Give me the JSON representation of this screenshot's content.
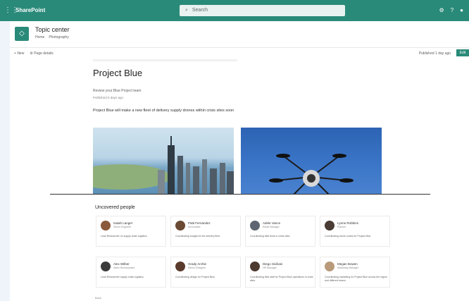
{
  "suitebar": {
    "app_name": "SharePoint",
    "search_placeholder": "Search",
    "waffle_icon": "waffle-icon",
    "icons": [
      "settings-icon",
      "help-icon",
      "avatar-icon"
    ]
  },
  "site": {
    "title": "Topic center",
    "nav": [
      "Home",
      "Photography"
    ]
  },
  "commandbar": {
    "new_label": "New",
    "page_details_label": "Page details",
    "status_label": "Published 1 day ago",
    "publish_label": "Edit"
  },
  "page": {
    "title": "Project Blue",
    "author": "Review your Blue Project team",
    "date": "Published 5 days ago",
    "intro": "Project Blue will make a new fleet of delivery supply drones within crisis sites soon"
  },
  "people_section": {
    "title": "Uncovered people",
    "people": [
      {
        "name": "Isaiah Langer",
        "role": "Senior Engineer",
        "desc": "Lead Researcher on supply chain logistics"
      },
      {
        "name": "Patti Fernandez",
        "role": "Accountant",
        "desc": "Coordinating budget for the delivery fleet"
      },
      {
        "name": "Adele Vance",
        "role": "Retail Manager",
        "desc": "Coordinating field tests in crisis sites"
      },
      {
        "name": "Lynne Robbins",
        "role": "Planner",
        "desc": "Coordinating drone routes for Project Blue"
      },
      {
        "name": "Alex Wilber",
        "role": "Sales Development",
        "desc": "Lead Researcher supply chain logistics"
      },
      {
        "name": "Grady Archie",
        "role": "Senior Designer",
        "desc": "Coordinating design for Project Blue"
      },
      {
        "name": "Diego Siciliani",
        "role": "HR Manager",
        "desc": "Coordinating field staff for Project Blue operations in crisis sites"
      },
      {
        "name": "Megan Bowen",
        "role": "Marketing Manager",
        "desc": "Coordinating marketing for Project Blue across the region and different teams"
      }
    ]
  },
  "footer": {
    "link": "Back"
  }
}
